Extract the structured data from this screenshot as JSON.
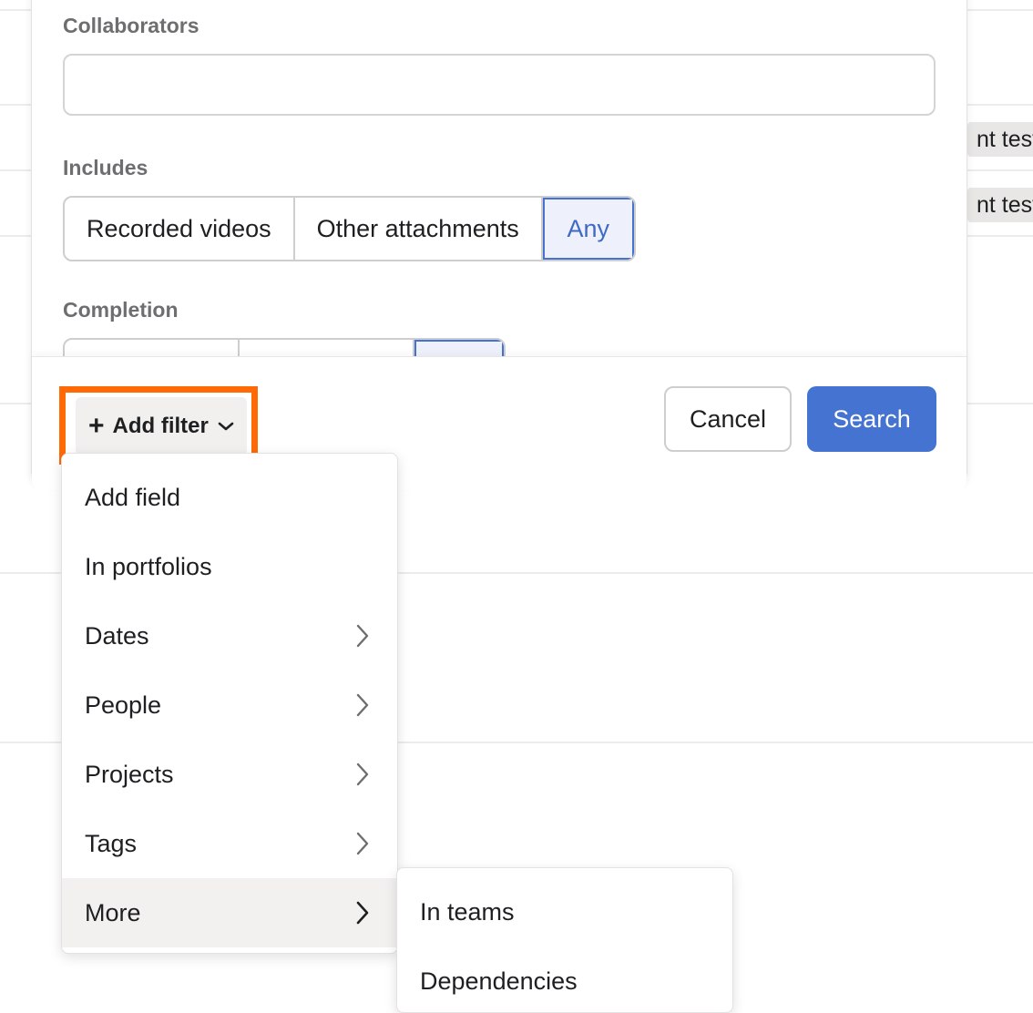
{
  "background": {
    "tags": [
      "nt test p",
      "nt test p"
    ]
  },
  "form": {
    "collaborators_label": "Collaborators",
    "collaborators_value": "",
    "includes_label": "Includes",
    "includes_options": [
      "Recorded videos",
      "Other attachments",
      "Any"
    ],
    "includes_selected": "Any",
    "completion_label": "Completion"
  },
  "footer": {
    "add_filter_label": "Add filter",
    "cancel_label": "Cancel",
    "search_label": "Search"
  },
  "menu": {
    "items": [
      {
        "label": "Add field",
        "has_submenu": false
      },
      {
        "label": "In portfolios",
        "has_submenu": false
      },
      {
        "label": "Dates",
        "has_submenu": true
      },
      {
        "label": "People",
        "has_submenu": true
      },
      {
        "label": "Projects",
        "has_submenu": true
      },
      {
        "label": "Tags",
        "has_submenu": true
      },
      {
        "label": "More",
        "has_submenu": true,
        "hovered": true
      }
    ]
  },
  "submenu": {
    "items": [
      {
        "label": "In teams"
      },
      {
        "label": "Dependencies"
      }
    ]
  },
  "colors": {
    "accent": "#4573d2",
    "highlight": "#ff6a06",
    "label_gray": "#6d6e6f"
  }
}
